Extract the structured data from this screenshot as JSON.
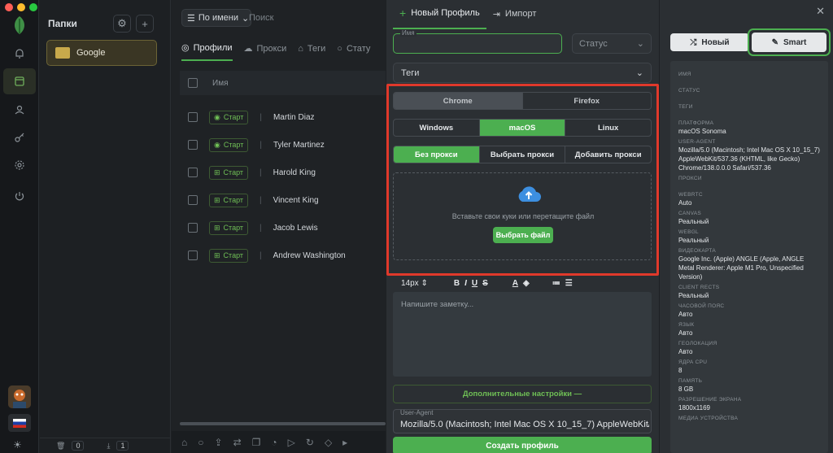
{
  "folders": {
    "title": "Папки",
    "items": [
      {
        "label": "Google"
      }
    ],
    "counts": [
      "0",
      "1"
    ]
  },
  "list": {
    "sort_label": "По имени",
    "search_placeholder": "Поиск",
    "tabs": [
      "Профили",
      "Прокси",
      "Теги",
      "Стату"
    ],
    "header_name": "Имя",
    "start_label": "Старт",
    "rows": [
      "Martin Diaz",
      "Tyler Martinez",
      "Harold King",
      "Vincent King",
      "Jacob Lewis",
      "Andrew Washington"
    ]
  },
  "modal": {
    "tabs": [
      "Новый Профиль",
      "Импорт"
    ],
    "name_label": "Имя",
    "status_placeholder": "Статус",
    "tags_label": "Теги",
    "browsers": [
      "Chrome",
      "Firefox"
    ],
    "os": [
      "Windows",
      "macOS",
      "Linux"
    ],
    "proxy": [
      "Без прокси",
      "Выбрать прокси",
      "Добавить прокси"
    ],
    "drop_text": "Вставьте свои куки или перетащите файл",
    "choose_file": "Выбрать файл",
    "font_size": "14px",
    "editor_placeholder": "Напишите заметку...",
    "advanced": "Дополнительные настройки —",
    "ua_label": "User-Agent",
    "ua_value": "Mozilla/5.0 (Macintosh; Intel Mac OS X 10_15_7) AppleWebKit/5",
    "create": "Создать профиль"
  },
  "panel": {
    "new_btn": "Новый",
    "smart_btn": "Smart",
    "info": [
      {
        "label": "ИМЯ",
        "value": ""
      },
      {
        "label": "СТАТУС",
        "value": ""
      },
      {
        "label": "ТЕГИ",
        "value": ""
      },
      {
        "label": "ПЛАТФОРМА",
        "value": "macOS Sonoma"
      },
      {
        "label": "USER-AGENT",
        "value": "Mozilla/5.0 (Macintosh; Intel Mac OS X 10_15_7) AppleWebKit/537.36 (KHTML, like Gecko) Chrome/138.0.0.0 Safari/537.36"
      },
      {
        "label": "ПРОКСИ",
        "value": ""
      },
      {
        "label": "WEBRTC",
        "value": "Auto"
      },
      {
        "label": "CANVAS",
        "value": "Реальный"
      },
      {
        "label": "WEBGL",
        "value": "Реальный"
      },
      {
        "label": "ВИДЕОКАРТА",
        "value": "Google Inc. (Apple) ANGLE (Apple, ANGLE Metal Renderer: Apple M1 Pro, Unspecified Version)"
      },
      {
        "label": "CLIENT RECTS",
        "value": "Реальный"
      },
      {
        "label": "ЧАСОВОЙ ПОЯС",
        "value": "Авто"
      },
      {
        "label": "ЯЗЫК",
        "value": "Авто"
      },
      {
        "label": "ГЕОЛОКАЦИЯ",
        "value": "Авто"
      },
      {
        "label": "ЯДРА CPU",
        "value": "8"
      },
      {
        "label": "ПАМЯТЬ",
        "value": "8 GB"
      },
      {
        "label": "РАЗРЕШЕНИЕ ЭКРАНА",
        "value": "1800x1169"
      },
      {
        "label": "МЕДИА УСТРОЙСТВА",
        "value": ""
      }
    ]
  },
  "colors": {
    "accent": "#4caf50",
    "highlight": "#e0392b",
    "folder": "#c8a94b"
  }
}
